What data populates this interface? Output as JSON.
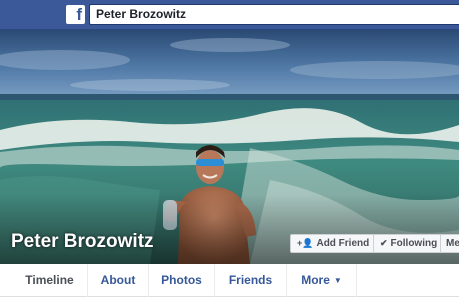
{
  "header": {
    "logo": "f",
    "search_value": "Peter Brozowitz"
  },
  "profile": {
    "name": "Peter Brozowitz",
    "add_friend_label": "Add Friend",
    "following_label": "Following",
    "more_label": "Me"
  },
  "tabs": [
    {
      "label": "Timeline"
    },
    {
      "label": "About"
    },
    {
      "label": "Photos"
    },
    {
      "label": "Friends"
    },
    {
      "label": "More"
    }
  ],
  "colors": {
    "brand": "#3b5998",
    "link": "#365899"
  }
}
